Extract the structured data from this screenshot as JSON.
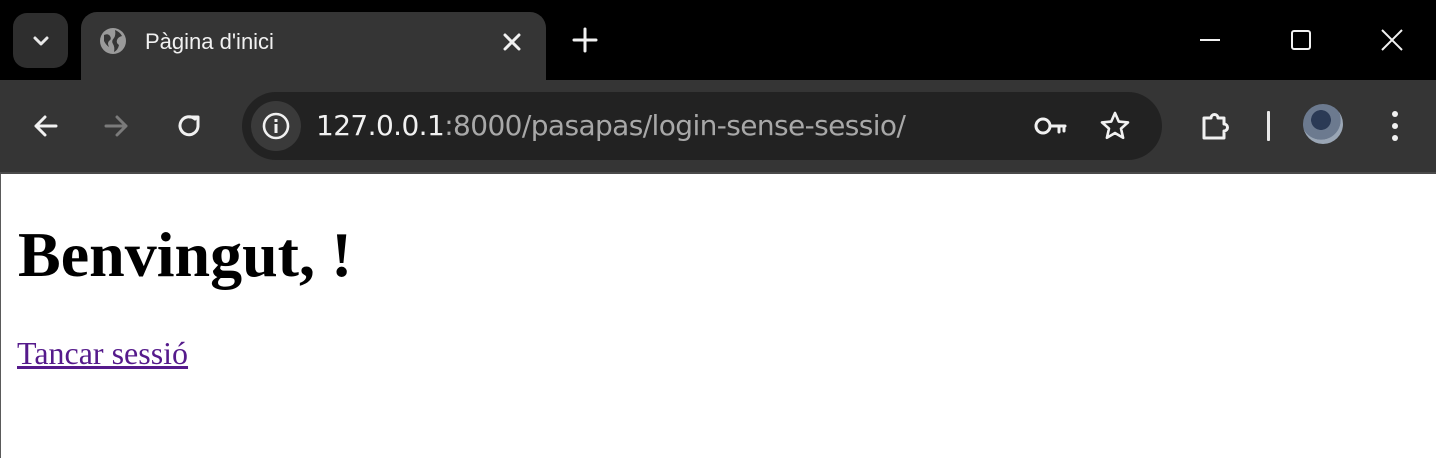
{
  "browser": {
    "tab": {
      "title": "Pàgina d'inici"
    },
    "address_bar": {
      "url_host": "127.0.0.1",
      "url_rest": ":8000/pasapas/login-sense-sessio/"
    },
    "icons": {
      "tab_search": "chevron-down-icon",
      "favicon": "globe-icon",
      "close_tab": "close-icon",
      "new_tab": "plus-icon",
      "minimize": "minimize-icon",
      "maximize": "maximize-icon",
      "close_window": "close-icon",
      "back": "arrow-left-icon",
      "forward": "arrow-right-icon",
      "reload": "reload-icon",
      "site_info": "info-icon",
      "password": "key-icon",
      "bookmark": "star-icon",
      "extensions": "puzzle-icon",
      "menu": "kebab-menu-icon"
    },
    "colors": {
      "titlebar": "#000000",
      "toolbar": "#353535",
      "omnibox": "#222222"
    }
  },
  "page": {
    "heading": "Benvingut, !",
    "logout_link": "Tancar sessió",
    "link_color": "#551a8b"
  }
}
